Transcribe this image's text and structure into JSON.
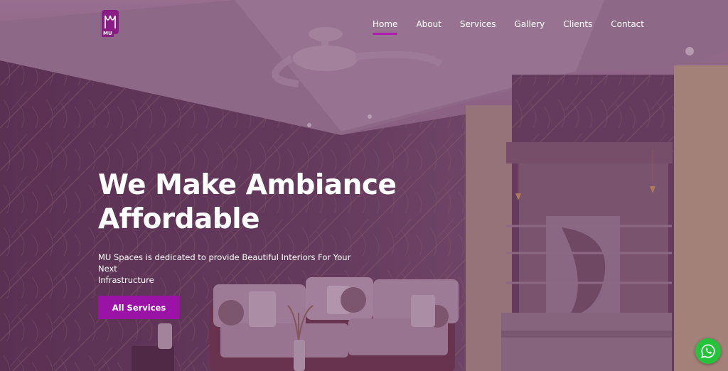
{
  "logo": {
    "text": "MU"
  },
  "nav": {
    "items": [
      "Home",
      "About",
      "Services",
      "Gallery",
      "Clients",
      "Contact"
    ],
    "active": "Home"
  },
  "hero": {
    "title_line1": "We Make Ambiance",
    "title_line2": "Affordable",
    "subtitle_line1": "MU Spaces is dedicated to provide Beautiful Interiors For Your Next",
    "subtitle_line2": "Infrastructure",
    "cta_label": "All Services"
  },
  "colors": {
    "accent": "#9a12a6",
    "nav_underline": "#b01bb0",
    "whatsapp": "#25c23c",
    "overlay": "#5c2856"
  },
  "icons": [
    "logo-icon",
    "ceiling-fan-illustration",
    "whatsapp-icon"
  ]
}
